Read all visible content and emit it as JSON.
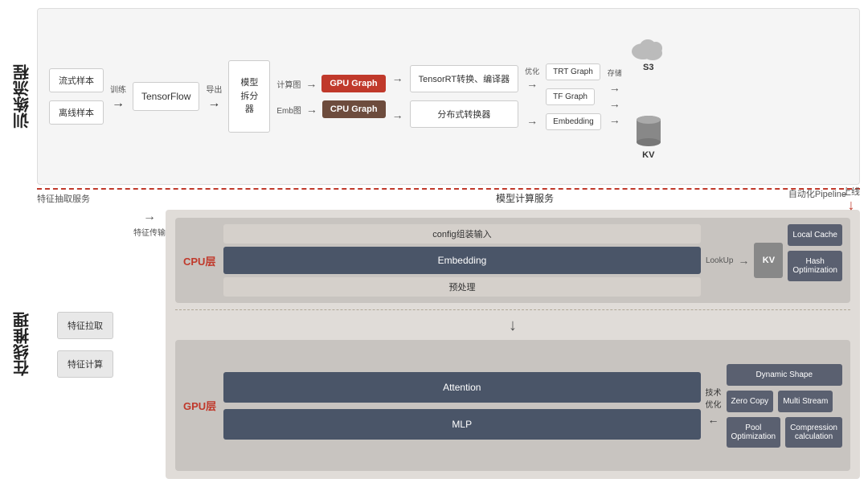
{
  "training": {
    "section_label": "训练流程",
    "samples": {
      "stream": "流式样本",
      "offline": "离线样本"
    },
    "train_label": "训练",
    "export_label": "导出",
    "tensorflow": "TensorFlow",
    "model_splitter": "模型\n拆分\n器",
    "compute_graph": "计算图",
    "emb_graph": "Emb图",
    "gpu_graph": "GPU Graph",
    "cpu_graph": "CPU Graph",
    "tensorrt_converter": "TensorRT转换、编译器",
    "distributed_converter": "分布式转换器",
    "optimize_label": "优化",
    "trt_graph": "TRT Graph",
    "tf_graph": "TF Graph",
    "embedding": "Embedding",
    "store_label": "存储",
    "s3": "S3",
    "kv_store": "KV",
    "auto_pipeline": "自动化Pipeline",
    "online_label": "上线"
  },
  "inference": {
    "section_label": "在线推理",
    "feature_extraction_label": "特征抽取服务",
    "feature_pull": "特征拉取",
    "feature_compute": "特征计算",
    "feature_transfer": "特征传输",
    "model_service_label": "模型计算服务",
    "cpu_layer_label": "CPU层",
    "gpu_layer_label": "GPU层",
    "config_input": "config组装输入",
    "embedding": "Embedding",
    "preprocess": "预处理",
    "attention": "Attention",
    "mlp": "MLP",
    "lookup_label": "LookUp",
    "kv": "KV",
    "local_cache": "Local Cache",
    "hash_optimization": "Hash\nOptimization",
    "tech_opt_label": "技术\n优化",
    "dynamic_shape": "Dynamic Shape",
    "zero_copy": "Zero Copy",
    "multi_stream": "Multi Stream",
    "pool_optimization": "Pool\nOptimization",
    "compression_calculation": "Compression\ncalculation"
  }
}
